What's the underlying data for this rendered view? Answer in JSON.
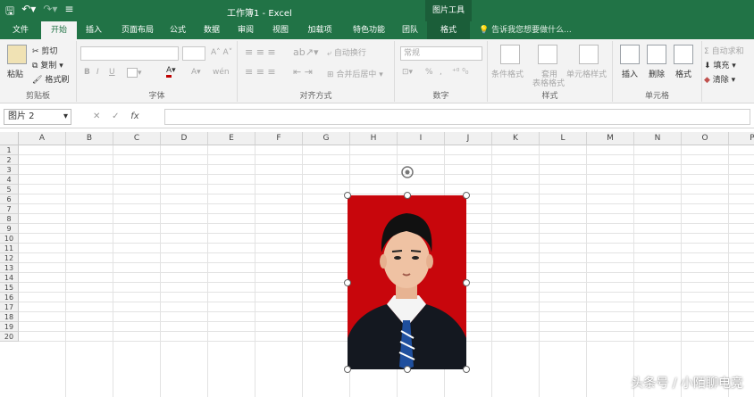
{
  "titlebar": {
    "title": "工作簿1 - Excel",
    "context_tools": "图片工具",
    "qat": [
      "save-icon",
      "undo-icon",
      "redo-icon",
      "customize-icon"
    ]
  },
  "tabs": [
    {
      "label": "文件"
    },
    {
      "label": "开始"
    },
    {
      "label": "插入"
    },
    {
      "label": "页面布局"
    },
    {
      "label": "公式"
    },
    {
      "label": "数据"
    },
    {
      "label": "审阅"
    },
    {
      "label": "视图"
    },
    {
      "label": "加载项"
    },
    {
      "label": "特色功能"
    },
    {
      "label": "团队"
    },
    {
      "label": "格式"
    }
  ],
  "search_placeholder": "告诉我您想要做什么...",
  "ribbon": {
    "clipboard": {
      "paste": "粘贴",
      "cut": "剪切",
      "copy": "复制",
      "format_painter": "格式刷",
      "label": "剪贴板"
    },
    "font": {
      "bold": "B",
      "italic": "I",
      "underline": "U",
      "label": "字体",
      "font_color": "A",
      "grow": "A",
      "shrink": "A",
      "phonetic": "wén"
    },
    "alignment": {
      "wrap": "自动换行",
      "merge": "合并后居中",
      "label": "对齐方式"
    },
    "number": {
      "format": "常规",
      "percent": "%",
      "comma": ",",
      "label": "数字"
    },
    "styles": {
      "conditional": "条件格式",
      "table1": "套用",
      "table2": "表格格式",
      "cell_styles": "单元格样式",
      "label": "样式"
    },
    "cells": {
      "insert": "插入",
      "delete": "删除",
      "format": "格式",
      "label": "单元格"
    },
    "editing": {
      "autosum": "自动求和",
      "fill": "填充",
      "clear": "清除"
    }
  },
  "formula_bar": {
    "name_box": "图片 2",
    "fx": "fx",
    "cancel": "✕",
    "enter": "✓",
    "value": ""
  },
  "columns": [
    "A",
    "B",
    "C",
    "D",
    "E",
    "F",
    "G",
    "H",
    "I",
    "J",
    "K",
    "L",
    "M",
    "N",
    "O",
    "P"
  ],
  "rows": [
    "1",
    "2",
    "3",
    "4",
    "5",
    "6",
    "7",
    "8",
    "9",
    "10",
    "11",
    "12",
    "13",
    "14",
    "15",
    "16",
    "17",
    "18",
    "19",
    "20"
  ],
  "watermark": "头条号 / 小陌聊电竞",
  "colors": {
    "excel_green": "#217346",
    "picture_bg": "#c8060c",
    "tie": "#1f4f9e"
  }
}
